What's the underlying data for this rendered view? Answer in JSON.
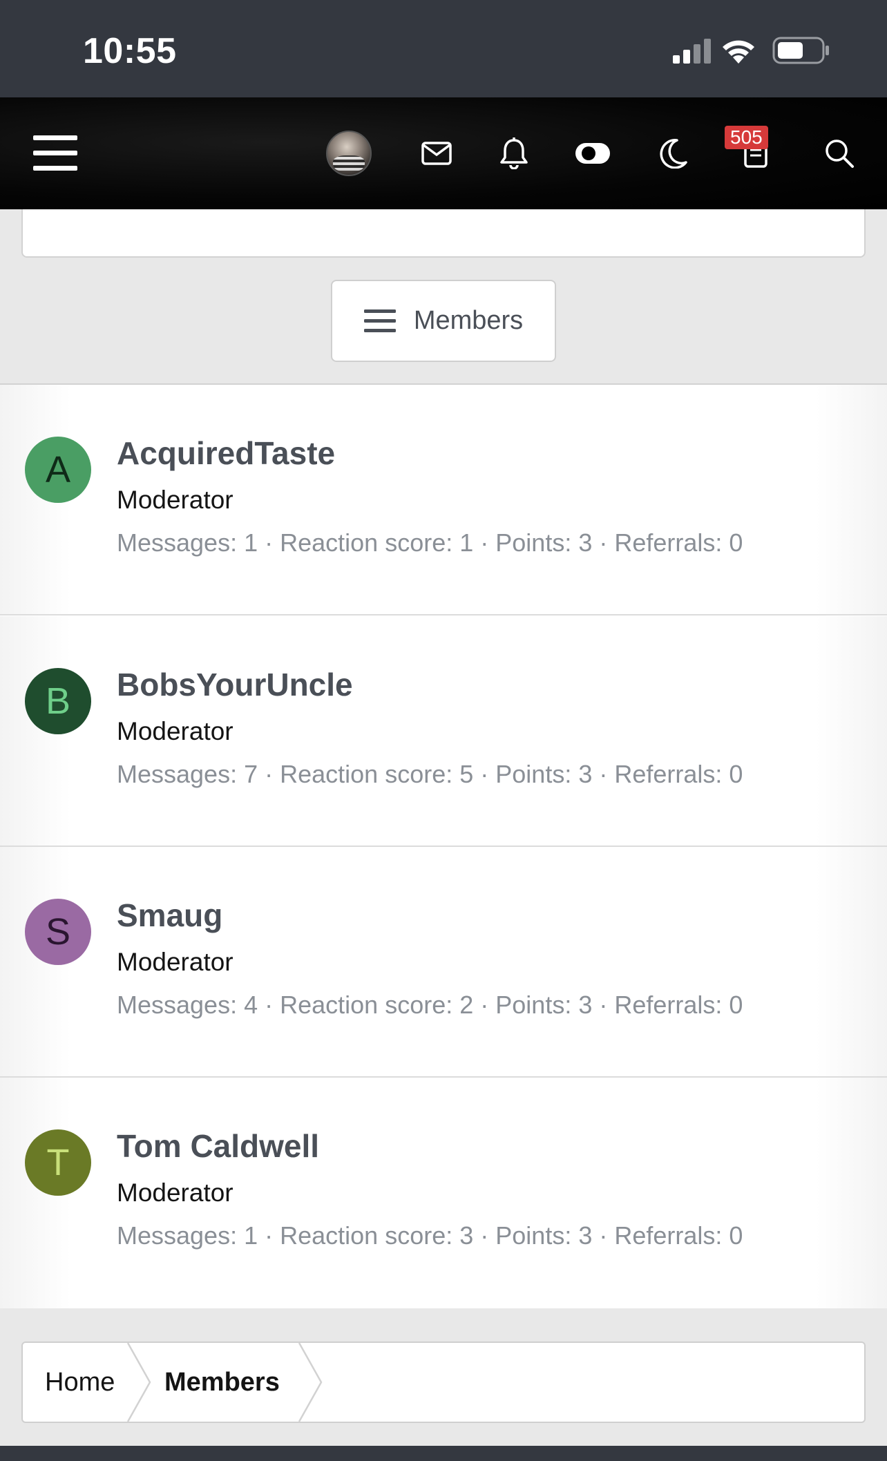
{
  "status_bar": {
    "time": "10:55"
  },
  "nav": {
    "notification_count": "505",
    "icons": [
      "hamburger-icon",
      "avatar",
      "mail-icon",
      "bell-icon",
      "toggle-icon",
      "moon-icon",
      "document-icon",
      "search-icon"
    ]
  },
  "members_menu": {
    "label": "Members"
  },
  "members": [
    {
      "initial": "A",
      "name": "AcquiredTaste",
      "role": "Moderator",
      "messages": "Messages: 1",
      "reaction": "Reaction score: 1",
      "points": "Points: 3",
      "referrals": "Referrals: 0",
      "avatar_bg": "#4a9e64",
      "avatar_fg": "#0f2a18"
    },
    {
      "initial": "B",
      "name": "BobsYourUncle",
      "role": "Moderator",
      "messages": "Messages: 7",
      "reaction": "Reaction score: 5",
      "points": "Points: 3",
      "referrals": "Referrals: 0",
      "avatar_bg": "#1f4d2e",
      "avatar_fg": "#6fcf8a"
    },
    {
      "initial": "S",
      "name": "Smaug",
      "role": "Moderator",
      "messages": "Messages: 4",
      "reaction": "Reaction score: 2",
      "points": "Points: 3",
      "referrals": "Referrals: 0",
      "avatar_bg": "#9a6aa3",
      "avatar_fg": "#2a1530"
    },
    {
      "initial": "T",
      "name": "Tom Caldwell",
      "role": "Moderator",
      "messages": "Messages: 1",
      "reaction": "Reaction score: 3",
      "points": "Points: 3",
      "referrals": "Referrals: 0",
      "avatar_bg": "#6a7a26",
      "avatar_fg": "#c9e07a"
    }
  ],
  "stat_separator": "·",
  "breadcrumb": {
    "home": "Home",
    "current": "Members"
  }
}
